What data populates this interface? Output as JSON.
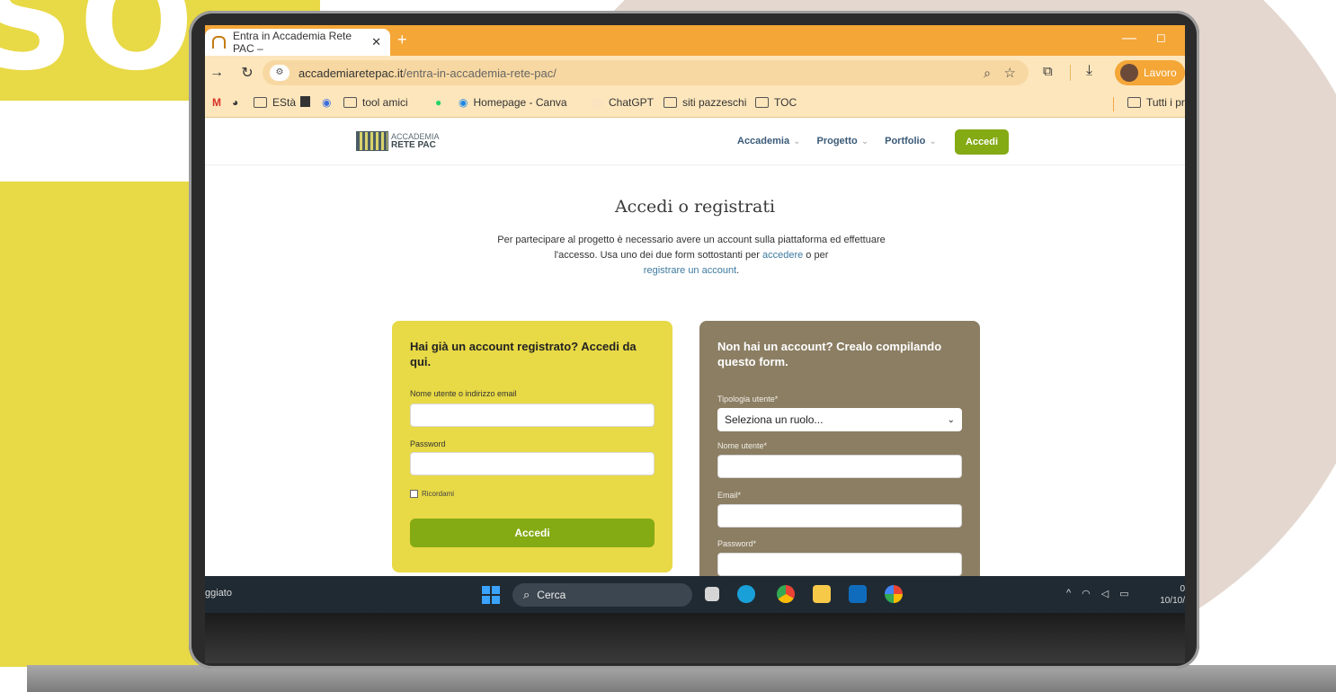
{
  "background": {
    "letters": "SO"
  },
  "browser": {
    "tab_title": "Entra in Accademia Rete PAC –",
    "tab_close": "✕",
    "new_tab": "+",
    "url_domain": "accademiaretepac.it",
    "url_path": "/entra-in-accademia-rete-pac/",
    "profile_label": "Lavoro",
    "bookmarks": [
      "EStà",
      "tool amici",
      "Homepage - Canva",
      "ChatGPT",
      "siti pazzeschi",
      "TOC",
      "Tutti i pr"
    ]
  },
  "site": {
    "logo_top": "ACCADEMIA",
    "logo_bottom": "RETE PAC",
    "menu": [
      "Accademia",
      "Progetto",
      "Portfolio"
    ],
    "login_button": "Accedi"
  },
  "page": {
    "title": "Accedi o registrati",
    "intro_1": "Per partecipare al progetto è necessario avere un account sulla piattaforma ed effettuare l'accesso. Usa uno dei due form sottostanti per ",
    "intro_link_1": "accedere",
    "intro_2": " o per ",
    "intro_link_2": "registrare un account",
    "intro_3": "."
  },
  "login_form": {
    "title": "Hai già un account registrato? Accedi da qui.",
    "username_label": "Nome utente o indirizzo email",
    "password_label": "Password",
    "remember_label": "Ricordami",
    "submit_label": "Accedi"
  },
  "register_form": {
    "title": "Non hai un account? Crealo compilando questo form.",
    "role_label": "Tipologia utente*",
    "role_selected": "Seleziona un ruolo...",
    "username_label": "Nome utente*",
    "email_label": "Email*",
    "password_label": "Password*"
  },
  "taskbar": {
    "left_text": "ggiato",
    "search_label": "Cerca",
    "clock_time": "0",
    "clock_date": "10/10/"
  },
  "colors": {
    "yellow": "#e8d946",
    "beige": "#e4d7cf",
    "browser_orange": "#f4a637",
    "green_button": "#84aa14",
    "card_brown": "#8b7e63"
  }
}
